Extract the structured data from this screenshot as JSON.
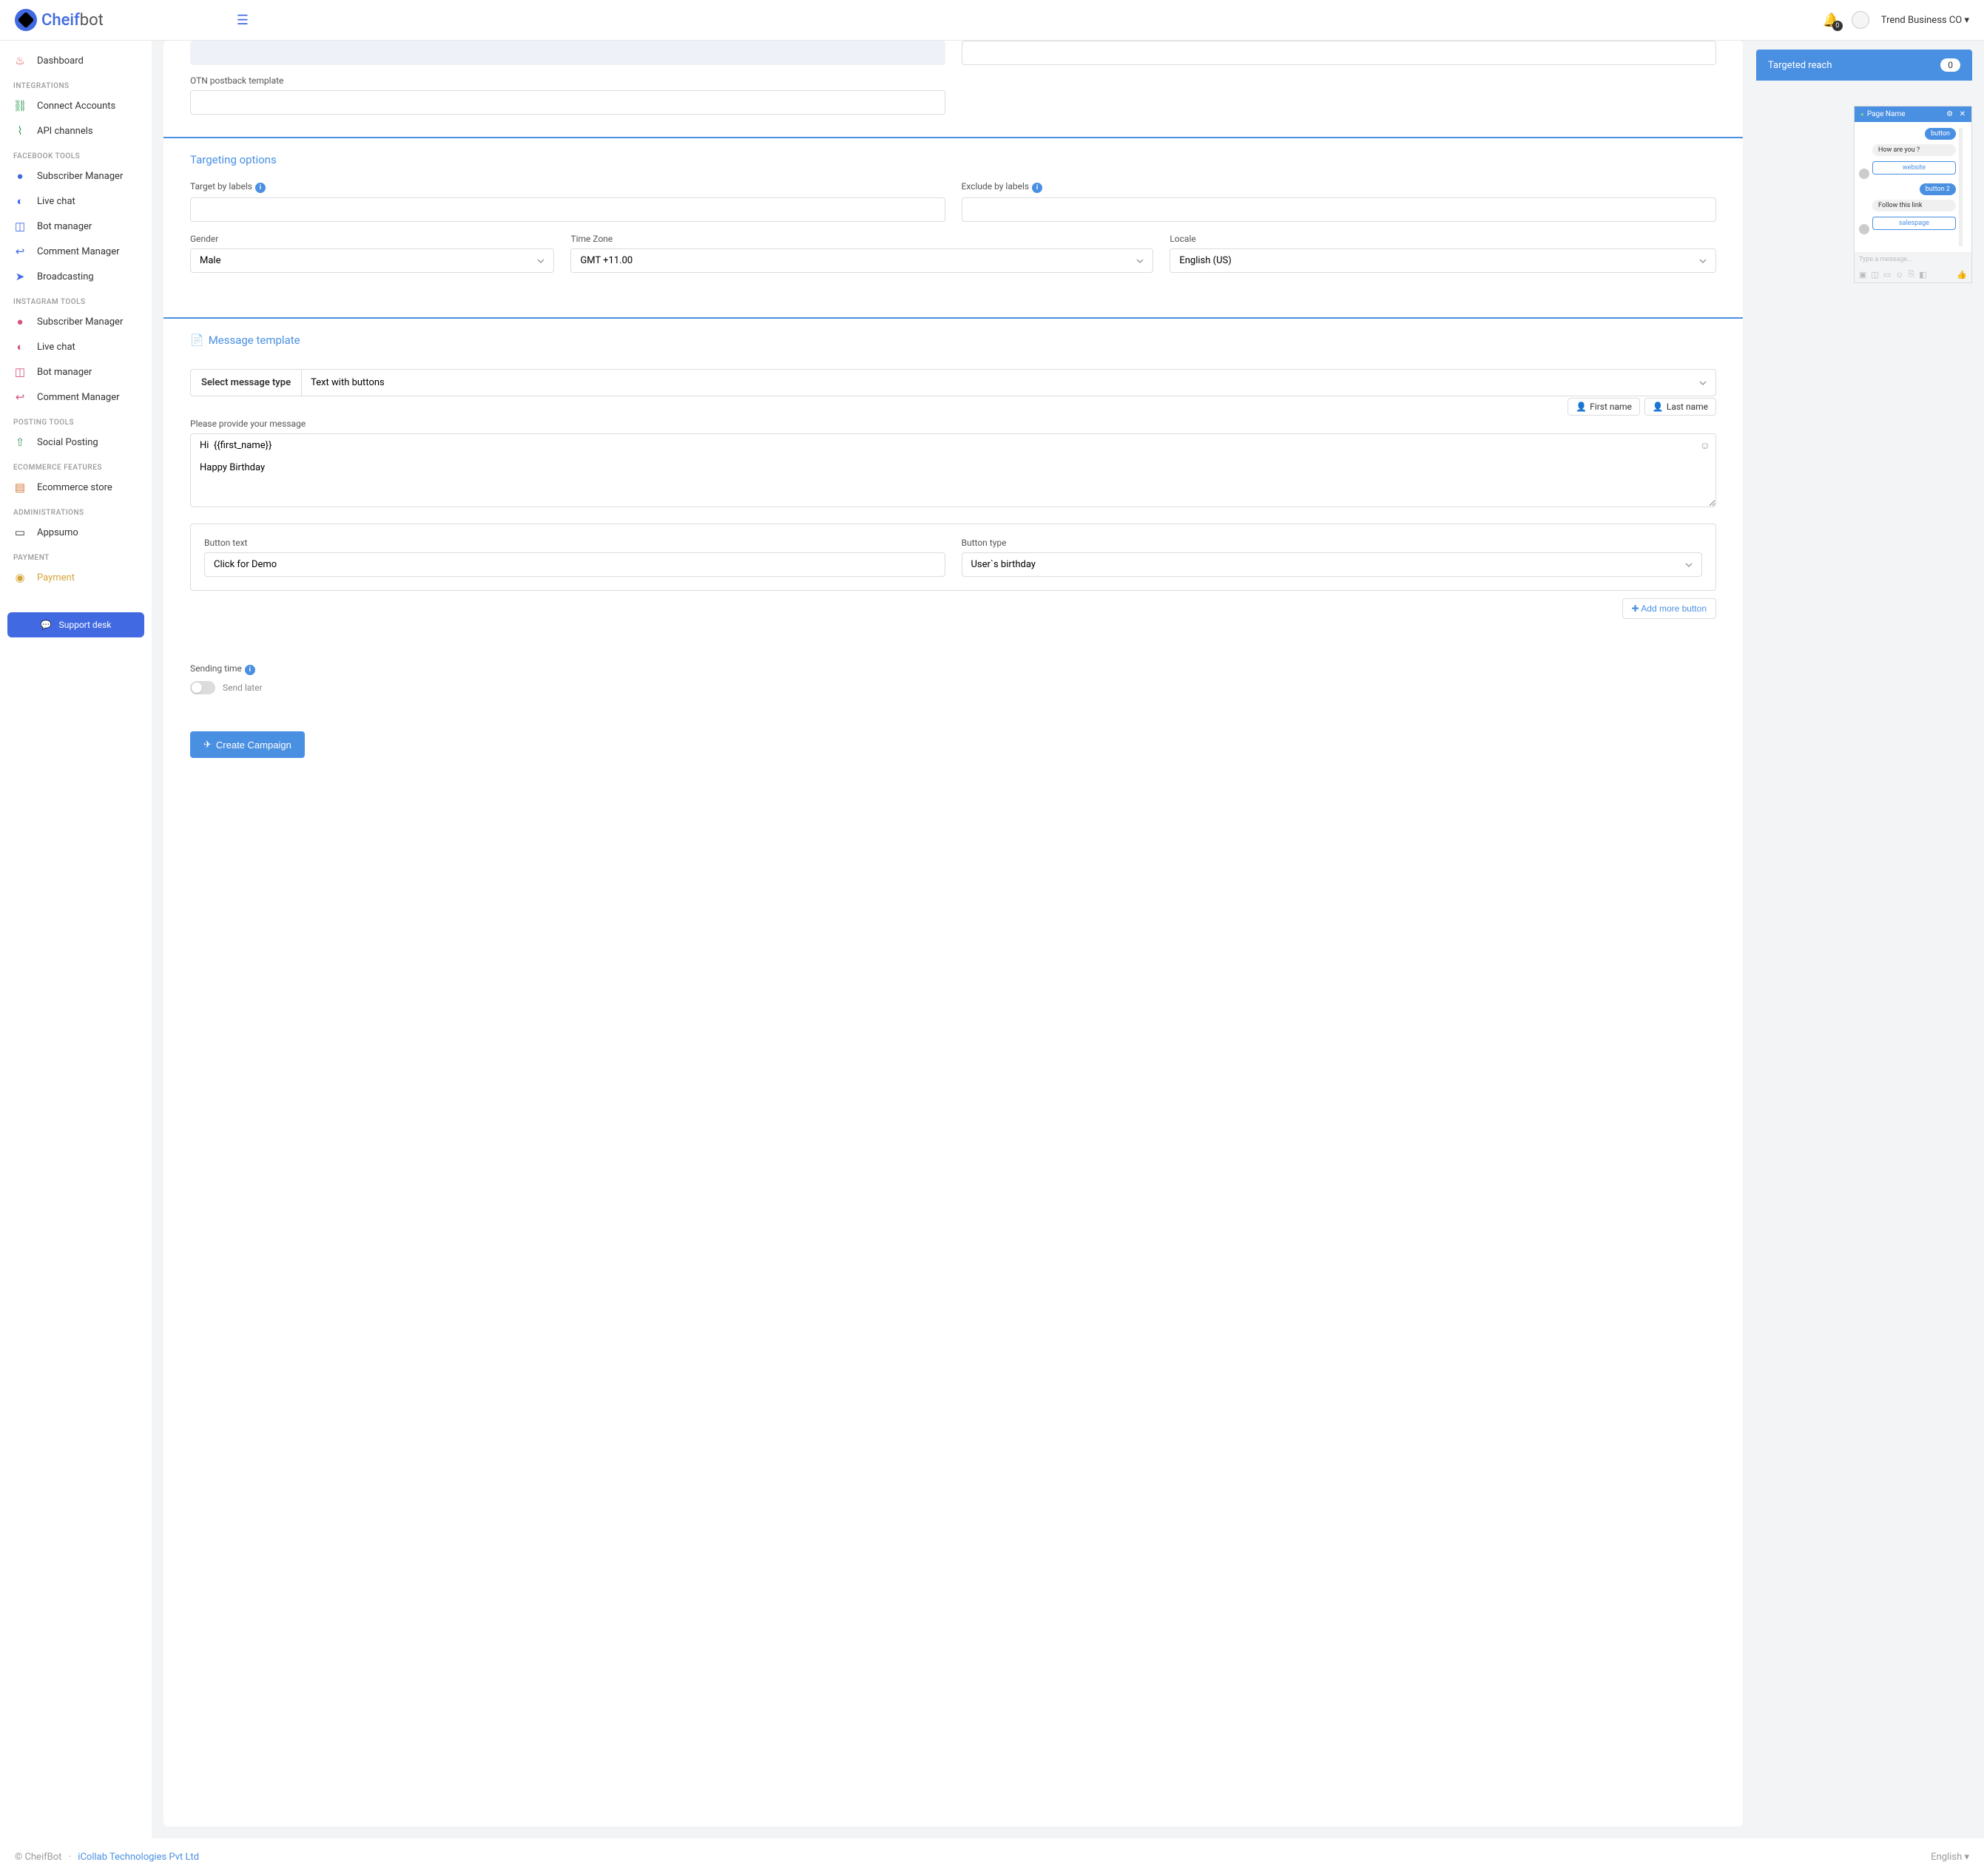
{
  "header": {
    "logo_text_a": "Cheif",
    "logo_text_b": "bot",
    "notif_count": "0",
    "account_name": "Trend Business CO"
  },
  "sidebar": {
    "items_top": [
      {
        "label": "Dashboard",
        "icon": "🔥",
        "color": "c-red"
      }
    ],
    "section_integrations": "INTEGRATIONS",
    "items_integrations": [
      {
        "label": "Connect Accounts",
        "icon": "🔗",
        "color": "c-green"
      },
      {
        "label": "API channels",
        "icon": "📶",
        "color": "c-green"
      }
    ],
    "section_facebook": "FACEBOOK TOOLS",
    "items_facebook": [
      {
        "label": "Subscriber Manager",
        "icon": "👤",
        "color": "c-blue"
      },
      {
        "label": "Live chat",
        "icon": "🎧",
        "color": "c-blue"
      },
      {
        "label": "Bot manager",
        "icon": "🤖",
        "color": "c-blue"
      },
      {
        "label": "Comment Manager",
        "icon": "↩",
        "color": "c-blue"
      },
      {
        "label": "Broadcasting",
        "icon": "✈",
        "color": "c-blue"
      }
    ],
    "section_instagram": "INSTAGRAM TOOLS",
    "items_instagram": [
      {
        "label": "Subscriber Manager",
        "icon": "👤",
        "color": "c-pink"
      },
      {
        "label": "Live chat",
        "icon": "🎧",
        "color": "c-pink"
      },
      {
        "label": "Bot manager",
        "icon": "🤖",
        "color": "c-pink"
      },
      {
        "label": "Comment Manager",
        "icon": "↩",
        "color": "c-pink"
      }
    ],
    "section_posting": "POSTING TOOLS",
    "items_posting": [
      {
        "label": "Social Posting",
        "icon": "📤",
        "color": "c-green"
      }
    ],
    "section_ecommerce": "ECOMMERCE FEATURES",
    "items_ecommerce": [
      {
        "label": "Ecommerce store",
        "icon": "🏪",
        "color": "c-orange"
      }
    ],
    "section_admin": "ADMINISTRATIONS",
    "items_admin": [
      {
        "label": "Appsumo",
        "icon": "🪪",
        "color": ""
      }
    ],
    "section_payment": "PAYMENT",
    "items_payment": [
      {
        "label": "Payment",
        "icon": "💰",
        "color": "c-yellow"
      }
    ],
    "support_label": "Support desk"
  },
  "form": {
    "otn_label": "OTN postback template",
    "targeting_title": "Targeting options",
    "target_labels": "Target by labels",
    "exclude_labels": "Exclude by labels",
    "gender_label": "Gender",
    "gender_value": "Male",
    "timezone_label": "Time Zone",
    "timezone_value": "GMT +11.00",
    "locale_label": "Locale",
    "locale_value": "English (US)",
    "message_template_title": "Message template",
    "select_msg_type_label": "Select message type",
    "select_msg_type_value": "Text with buttons",
    "msg_label": "Please provide your message",
    "first_name_badge": "First name",
    "last_name_badge": "Last name",
    "msg_value": "Hi  {{first_name}}\n\nHappy Birthday",
    "button_text_label": "Button text",
    "button_text_value": "Click for Demo",
    "button_type_label": "Button type",
    "button_type_value": "User`s birthday",
    "add_more_button": "Add more button",
    "sending_time_label": "Sending time",
    "send_later_label": "Send later",
    "create_button": "Create Campaign"
  },
  "side": {
    "targeted_reach_label": "Targeted reach",
    "targeted_reach_count": "0",
    "chat_page_name": "Page Name",
    "chat": {
      "button_label": "button",
      "q1": "How are you ?",
      "btn1": "website",
      "button_2": "button 2",
      "q2": "Follow this link",
      "btn2": "salespage",
      "input_placeholder": "Type a message..."
    }
  },
  "footer": {
    "copyright": "© CheifBot",
    "company": "iCollab Technologies Pvt Ltd",
    "language": "English"
  }
}
